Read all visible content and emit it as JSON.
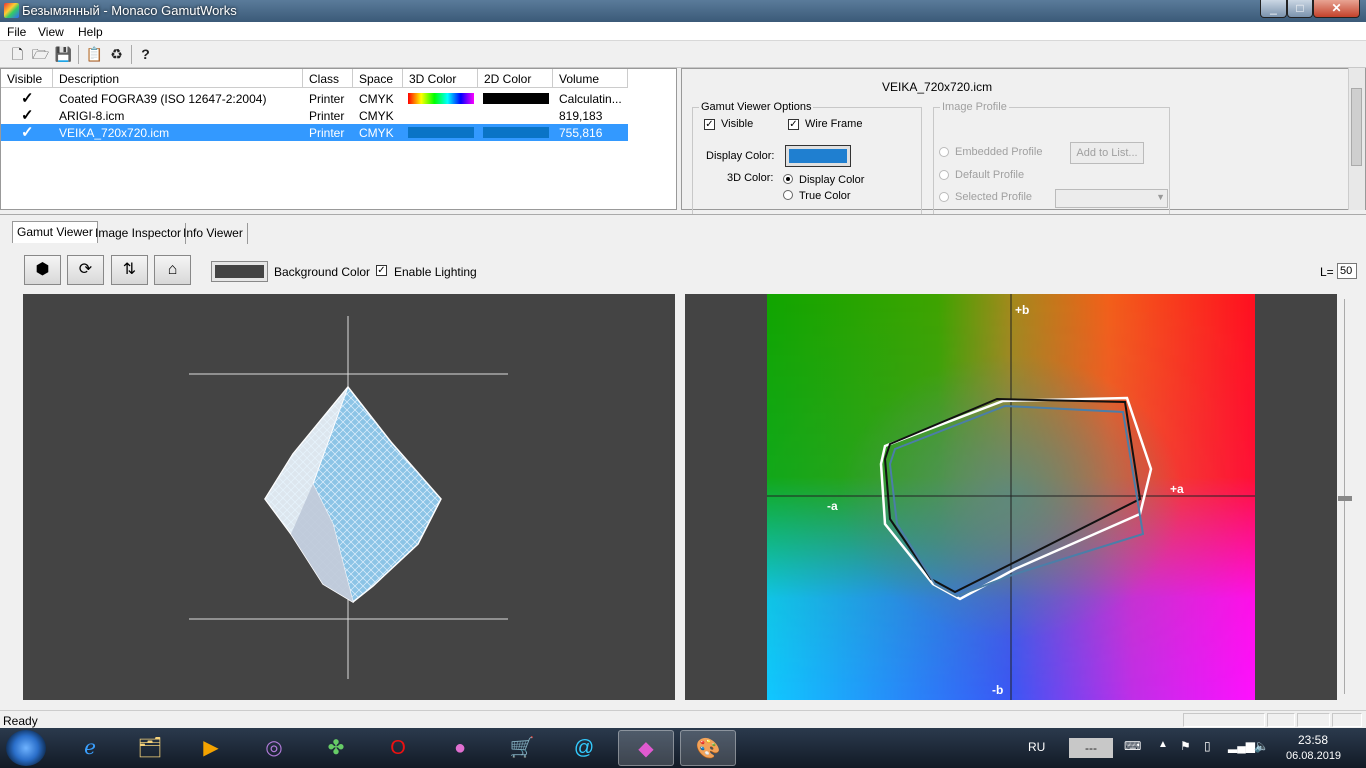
{
  "window": {
    "title": "Безымянный - Monaco GamutWorks",
    "close_label": "✕",
    "max_label": "□",
    "min_label": "_"
  },
  "menu": [
    "File",
    "View",
    "Help"
  ],
  "list": {
    "columns": [
      "Visible",
      "Description",
      "Class",
      "Space",
      "3D Color",
      "2D Color",
      "Volume"
    ],
    "rows": [
      {
        "description": "Coated FOGRA39 (ISO 12647-2:2004)",
        "class": "Printer",
        "space": "CMYK",
        "volume": "Calculatin...",
        "selected": false
      },
      {
        "description": "ARIGI-8.icm",
        "class": "Printer",
        "space": "CMYK",
        "volume": "819,183",
        "selected": false
      },
      {
        "description": "VEIKA_720x720.icm",
        "class": "Printer",
        "space": "CMYK",
        "volume": "755,816",
        "selected": true
      }
    ],
    "check_glyph": "✓"
  },
  "options": {
    "profile_title": "VEIKA_720x720.icm",
    "gamut_group": "Gamut Viewer Options",
    "visible_label": "Visible",
    "wireframe_label": "Wire Frame",
    "display_color_label": "Display Color:",
    "color3d_label": "3D Color:",
    "display_color_radio": "Display Color",
    "true_color_radio": "True Color",
    "image_group": "Image Profile",
    "embedded": "Embedded Profile",
    "default": "Default Profile",
    "selected": "Selected Profile",
    "add_to_list": "Add to List...",
    "display_color_hex": "#1f7fd0"
  },
  "tabs": [
    "Gamut Viewer",
    "Image Inspector",
    "Info Viewer"
  ],
  "viewer": {
    "background_color_label": "Background Color",
    "enable_lighting_label": "Enable Lighting",
    "l_label": "L=",
    "l_value": "50",
    "axis_plus_b": "+b",
    "axis_minus_b": "-b",
    "axis_plus_a": "+a",
    "axis_minus_a": "-a"
  },
  "status": {
    "text": "Ready"
  },
  "taskbar": {
    "lang": "RU",
    "time": "23:58",
    "date": "06.08.2019",
    "dash": "---"
  },
  "colors": {
    "selection": "#3399ff",
    "viewport_bg": "#444444"
  }
}
